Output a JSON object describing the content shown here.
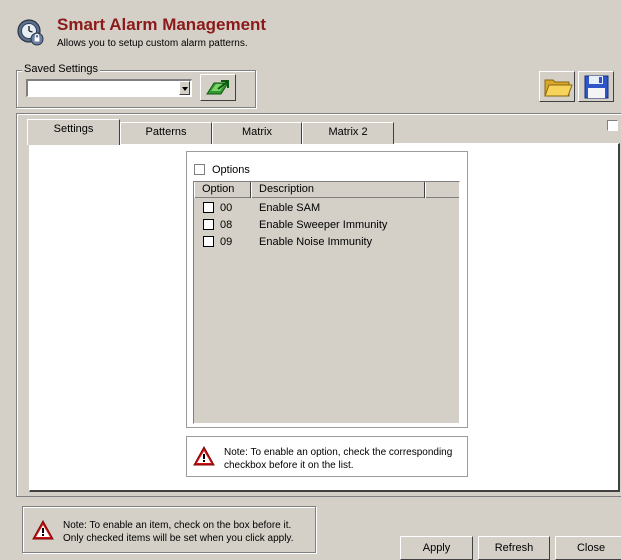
{
  "header": {
    "title": "Smart Alarm Management",
    "subtitle": "Allows you to setup custom alarm patterns.",
    "icon": "alarm-clock-icon"
  },
  "saved_settings": {
    "legend": "Saved Settings",
    "selected_value": "",
    "load_icon": "load-settings-icon",
    "open_icon": "open-folder-icon",
    "save_icon": "floppy-disk-icon"
  },
  "tabs": [
    {
      "label": "Settings",
      "active": true
    },
    {
      "label": "Patterns",
      "active": false
    },
    {
      "label": "Matrix",
      "active": false
    },
    {
      "label": "Matrix 2",
      "active": false
    }
  ],
  "options": {
    "header_label": "Options",
    "columns": [
      "Option",
      "Description",
      ""
    ],
    "rows": [
      {
        "code": "00",
        "description": "Enable SAM",
        "checked": false
      },
      {
        "code": "08",
        "description": "Enable Sweeper Immunity",
        "checked": false
      },
      {
        "code": "09",
        "description": "Enable Noise Immunity",
        "checked": false
      }
    ]
  },
  "inner_note": {
    "text": "Note: To enable an option, check the corresponding checkbox before it on the list.",
    "icon": "warning-icon"
  },
  "bottom_note": {
    "text": "Note: To enable an item, check on the box before it. Only checked items will be set when you click apply.",
    "icon": "warning-icon"
  },
  "buttons": {
    "apply": "Apply",
    "refresh": "Refresh",
    "close": "Close"
  },
  "colors": {
    "title": "#8b1a1a",
    "background": "#d4d0c8",
    "warning_red": "#cc1111"
  }
}
